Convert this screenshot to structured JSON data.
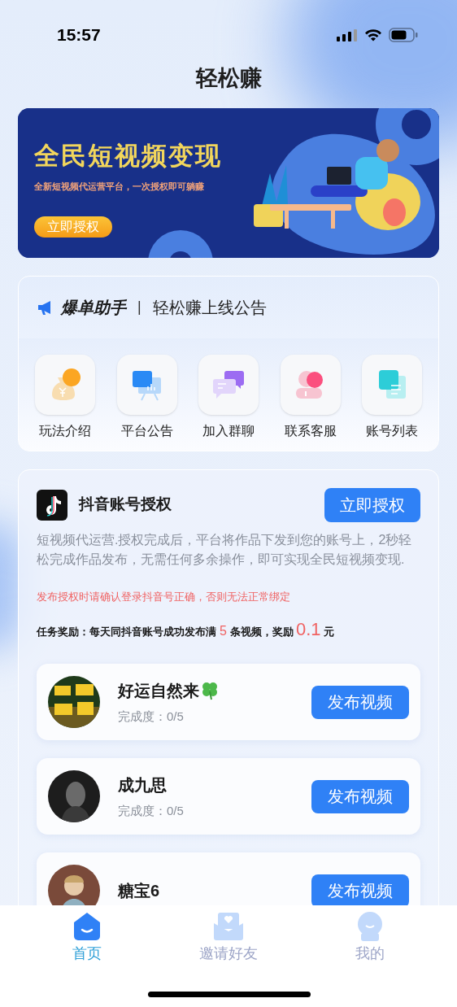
{
  "status_bar": {
    "time": "15:57"
  },
  "title": "轻松赚",
  "banner": {
    "headline": "全民短视频变现",
    "subtitle": "全新短视频代运营平台，一次授权即可躺赚",
    "button": "立即授权"
  },
  "notice": {
    "brand": "爆单助手",
    "separator": "|",
    "text": "轻松赚上线公告"
  },
  "shortcuts": [
    {
      "label": "玩法介绍",
      "kind": "money"
    },
    {
      "label": "平台公告",
      "kind": "board"
    },
    {
      "label": "加入群聊",
      "kind": "chat"
    },
    {
      "label": "联系客服",
      "kind": "service"
    },
    {
      "label": "账号列表",
      "kind": "list"
    }
  ],
  "auth": {
    "title": "抖音账号授权",
    "button": "立即授权",
    "description": "短视频代运营.授权完成后，平台将作品下发到您的账号上，2秒轻松完成作品发布，无需任何多余操作，即可实现全民短视频变现.",
    "warning": "发布授权时请确认登录抖音号正确，否则无法正常绑定",
    "reward": [
      {
        "text": "任务奖励：每天同抖音账号成功发布满",
        "kind": "text"
      },
      {
        "text": "5",
        "kind": "count"
      },
      {
        "text": "条视频，奖励",
        "kind": "text"
      },
      {
        "text": "0.1",
        "kind": "amount"
      },
      {
        "text": "元",
        "kind": "text"
      }
    ]
  },
  "accounts": [
    {
      "name": "好运自然来",
      "kind": "clover",
      "progress": "完成度：0/5",
      "button": "发布视频"
    },
    {
      "name": "成九思",
      "kind": "plain",
      "progress": "完成度：0/5",
      "button": "发布视频"
    },
    {
      "name": "糖宝6",
      "kind": "plain",
      "button": "发布视频"
    }
  ],
  "tabs": [
    {
      "label": "首页",
      "kind": "home",
      "selected": true
    },
    {
      "label": "邀请好友",
      "kind": "mail",
      "selected": false
    },
    {
      "label": "我的",
      "kind": "user",
      "selected": false
    }
  ]
}
